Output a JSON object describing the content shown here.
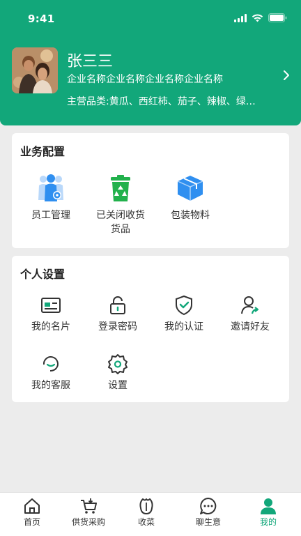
{
  "status_bar": {
    "time": "9:41"
  },
  "profile": {
    "name": "张三三",
    "company": "企业名称企业名称企业名称企业名称",
    "products": "主营品类:黄瓜、西红柿、茄子、辣椒、绿…"
  },
  "business": {
    "title": "业务配置",
    "items": [
      {
        "label": "员工管理",
        "icon": "employee-icon"
      },
      {
        "label": "已关闭收货货品",
        "icon": "recycle-bin-icon"
      },
      {
        "label": "包装物料",
        "icon": "package-box-icon"
      }
    ]
  },
  "personal": {
    "title": "个人设置",
    "items": [
      {
        "label": "我的名片",
        "icon": "id-card-icon"
      },
      {
        "label": "登录密码",
        "icon": "lock-icon"
      },
      {
        "label": "我的认证",
        "icon": "shield-check-icon"
      },
      {
        "label": "邀请好友",
        "icon": "user-invite-icon"
      },
      {
        "label": "我的客服",
        "icon": "headset-icon"
      },
      {
        "label": "设置",
        "icon": "gear-icon"
      }
    ]
  },
  "tabbar": {
    "items": [
      {
        "label": "首页",
        "icon": "home-icon"
      },
      {
        "label": "供货采购",
        "icon": "cart-icon"
      },
      {
        "label": "收菜",
        "icon": "vegetable-icon"
      },
      {
        "label": "聊生意",
        "icon": "chat-icon"
      },
      {
        "label": "我的",
        "icon": "profile-icon"
      }
    ],
    "active_index": 4
  },
  "colors": {
    "brand": "#12a77a",
    "blue": "#2f8ff0",
    "green_icon": "#22b14c"
  }
}
